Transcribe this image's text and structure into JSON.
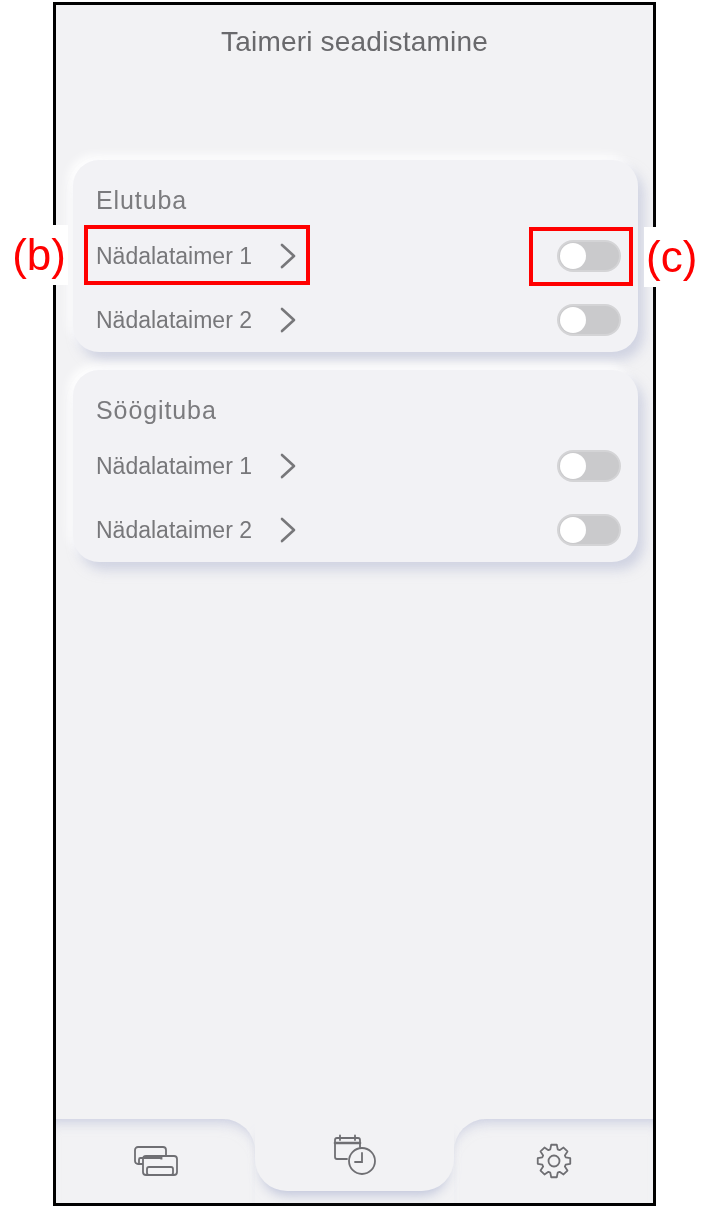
{
  "title": "Taimeri seadistamine",
  "rooms": [
    {
      "name": "Elutuba",
      "timers": [
        {
          "label": "Nädalataimer 1",
          "on": false
        },
        {
          "label": "Nädalataimer 2",
          "on": false
        }
      ]
    },
    {
      "name": "Söögituba",
      "timers": [
        {
          "label": "Nädalataimer 1",
          "on": false
        },
        {
          "label": "Nädalataimer 2",
          "on": false
        }
      ]
    }
  ],
  "bottom_nav": [
    {
      "kind": "devices",
      "selected": false
    },
    {
      "kind": "timer",
      "selected": true
    },
    {
      "kind": "settings",
      "selected": false
    }
  ],
  "annotations": [
    {
      "label": "(b)",
      "kind": "link"
    },
    {
      "label": "(c)",
      "kind": "switch"
    }
  ]
}
